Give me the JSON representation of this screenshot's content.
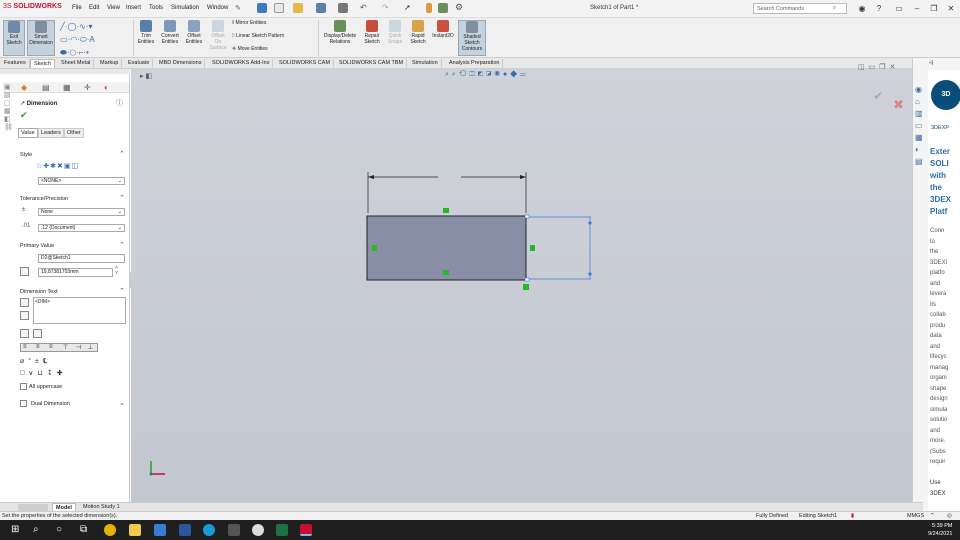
{
  "app": {
    "logo_ds": "3S",
    "logo_text": "SOLIDWORKS"
  },
  "title": "Sketch1 of Part1 *",
  "menu": [
    "File",
    "Edit",
    "View",
    "Insert",
    "Tools",
    "Simulation",
    "Window"
  ],
  "search": {
    "placeholder": "Search Commands"
  },
  "ribbon": {
    "exit_sketch": [
      "Exit",
      "Sketch"
    ],
    "smart_dimension": [
      "Smart",
      "Dimension"
    ],
    "trim": [
      "Trim",
      "Entities"
    ],
    "convert": [
      "Convert",
      "Entities"
    ],
    "offset": [
      "Offset",
      "Entities"
    ],
    "offset_surface": [
      "Offset",
      "On",
      "Surface"
    ],
    "mirror": "Mirror Entities",
    "linear_pattern": "Linear Sketch Pattern",
    "move": "Move Entities",
    "display_delete": [
      "Display/Delete",
      "Relations"
    ],
    "repair": [
      "Repair",
      "Sketch"
    ],
    "quick_snaps": [
      "Quick",
      "Snaps"
    ],
    "rapid": [
      "Rapid",
      "Sketch"
    ],
    "instant2d": "Instant2D",
    "shaded": [
      "Shaded",
      "Sketch",
      "Contours"
    ]
  },
  "tabs": [
    "Features",
    "Sketch",
    "Sheet Metal",
    "Markup",
    "Evaluate",
    "MBD Dimensions",
    "SOLIDWORKS Add-Ins",
    "SOLIDWORKS CAM",
    "SOLIDWORKS CAM TBM",
    "Simulation",
    "Analysis Preparation"
  ],
  "panel": {
    "title": "Dimension",
    "subtabs": [
      "Value",
      "Leaders",
      "Other"
    ],
    "style_label": "Style",
    "style_value": "<NONE>",
    "tolerance_label": "Tolerance/Precision",
    "tolerance_value": "None",
    "precision_value": ".12 (Document)",
    "primary_label": "Primary Value",
    "primary_name": "D2@Sketch1",
    "primary_value": "19.87381703mm",
    "dimtext_label": "Dimension Text",
    "dimtext_value": "<DIM>",
    "all_upper": "All uppercase",
    "dual_dim": "Dual Dimension"
  },
  "taskpane": {
    "badge": "3D",
    "brand": "3DEXP",
    "title_lines": [
      "Exter",
      "SOLI",
      "with",
      "the",
      "3DEX",
      "Platf"
    ],
    "body_lines": [
      "Conn",
      "to",
      "the",
      "3DEXI",
      "platfo",
      "and",
      "levera",
      "its",
      "collab",
      "produ",
      "data",
      "and",
      "lifecyc",
      "manag",
      "organi",
      "shape",
      "design",
      "simula",
      "solutio",
      "and",
      "more.",
      "(Subs",
      "requir",
      "",
      "Use",
      "3DEX"
    ]
  },
  "bottom_tabs": [
    "Model",
    "Motion Study 1"
  ],
  "status": {
    "hint": "Set the properties of the selected dimension(s).",
    "defined": "Fully Defined",
    "editing": "Editing Sketch1",
    "units": "MMGS"
  },
  "clock": {
    "time": "5:39 PM",
    "date": "9/24/2021"
  },
  "colors": {
    "accent": "#c8102e",
    "rect_fill": "#8a8fa8",
    "selection": "#3a7bd5",
    "handle": "#22bb22"
  }
}
